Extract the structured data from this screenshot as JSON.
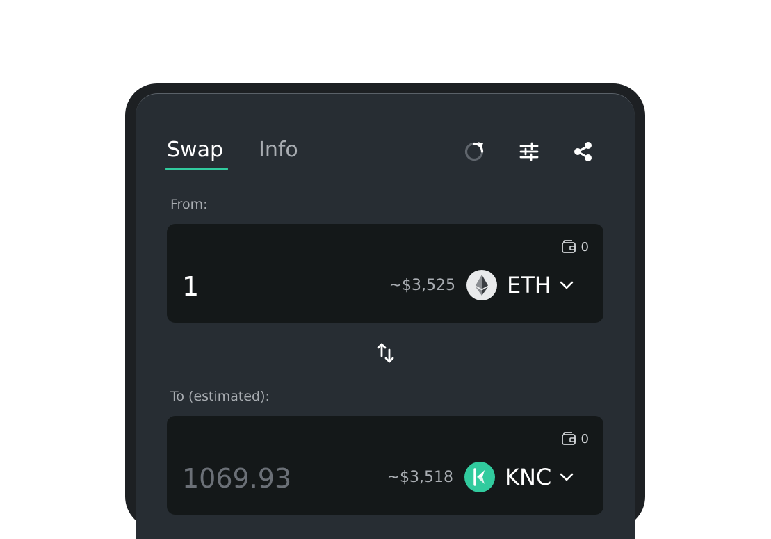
{
  "tabs": [
    {
      "label": "Swap",
      "active": true
    },
    {
      "label": "Info",
      "active": false
    }
  ],
  "toolbar": {
    "refresh_icon": "refresh-icon",
    "settings_icon": "sliders-icon",
    "share_icon": "share-icon"
  },
  "from": {
    "label": "From:",
    "balance": "0",
    "amount": "1",
    "usd_value": "~$3,525",
    "token": "ETH",
    "token_icon": "eth-icon"
  },
  "swap_direction_icon": "swap-arrows-icon",
  "to": {
    "label": "To (estimated):",
    "balance": "0",
    "amount": "1069.93",
    "usd_value": "~$3,518",
    "token": "KNC",
    "token_icon": "knc-icon"
  },
  "colors": {
    "accent": "#31cb9e",
    "panel_bg": "#272d33",
    "input_bg": "#141819",
    "device_frame": "#1d2023"
  }
}
